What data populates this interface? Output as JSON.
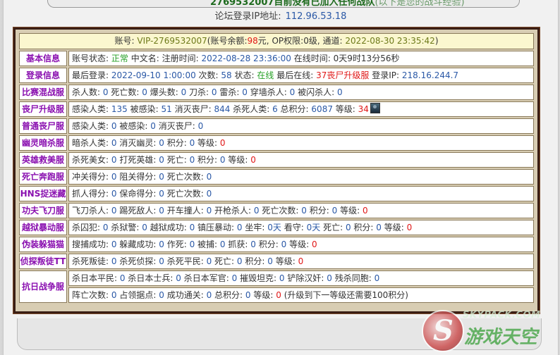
{
  "top_banner": {
    "text": "2769532007目前没有已加入任何战队",
    "tail": "(以下是您的战斗经验)"
  },
  "ip_bar": {
    "label": "论坛登录IP地址:",
    "value": "112.96.53.18"
  },
  "account": {
    "label": "账号:",
    "id": "VIP-2769532007",
    "balance_label": "(账号余额:",
    "balance": "98",
    "balance_unit": "元,",
    "op_label": "OP权限:",
    "op_level": "0",
    "op_unit": "级,",
    "channel_label": "通道:",
    "channel_time": "2022-08-30 23:35:42",
    "close": ")"
  },
  "rows": [
    {
      "cat": "基本信息",
      "text": "账号状态: 正常 中文名: 注册时间: 2022-08-28 23:36:00 在线时间: 0天9时13分56秒"
    },
    {
      "cat": "登录信息",
      "text": "最后登录: 2022-09-10 1:00:00 次数: 58 状态: 在线 最后在线: 37丧尸升级服 登录IP: 218.16.244.7"
    },
    {
      "cat": "比赛混战服",
      "text": "杀人数: 0 死亡数: 0 爆头数: 0 刀杀: 0 雷杀: 0 穿墙杀人: 0 被闪杀人: 0"
    },
    {
      "cat": "丧尸升级服",
      "text": "感染人类: 135 被感染: 51 消灭丧尸: 844 杀死人类: 6 总积分: 6087 等级: 34"
    },
    {
      "cat": "普通丧尸服",
      "text": "感染人类: 0 被感染: 0 消灭丧尸: 0"
    },
    {
      "cat": "幽灵暗杀服",
      "text": "暗杀人类: 0 消灭幽灵: 0 积分: 0 等级: 0"
    },
    {
      "cat": "英雄救美服",
      "text": "杀死美女: 0 打死英雄: 0 死亡: 0 积分: 0 等级: 0"
    },
    {
      "cat": "死亡奔跑服",
      "text": "冲关得分: 0 阻关得分: 0 死亡次数: 0"
    },
    {
      "cat": "HNS捉迷藏",
      "text": "抓人得分: 0 保命得分: 0 死亡次数: 0"
    },
    {
      "cat": "功夫飞刀服",
      "text": "飞刀杀人: 0 踢死敌人: 0 开车撞人: 0 开枪杀人: 0 死亡次数: 0 积分: 0 等级: 0"
    },
    {
      "cat": "越狱暴动服",
      "text": "杀囚犯: 0 杀狱警: 0 越狱成功: 0 镇压暴动: 0 坐牢: 0天 看守: 0天 死亡: 0 积分: 0 等级: 0"
    },
    {
      "cat": "伪装躲猫猫",
      "text": "搜捕成功: 0 躲藏成功: 0 作死: 0 被捕: 0 抓获: 0 积分: 0 等级: 0"
    },
    {
      "cat": "侦探叛徒TT",
      "text": "杀死叛徒: 0 杀死侦探: 0 杀死平民: 0 死亡: 0 积分: 0 等级: 0"
    }
  ],
  "antijapan": {
    "cat": "抗日战争服",
    "line1": "杀日本平民: 0 杀日本士兵: 0 杀日本军官: 0 摧毁坦克: 0 铲除汉奸: 0 残杀同胞: 0",
    "line2": "阵亡次数: 0 占领据点: 0 成功通关: 0 总积分: 0 等级: 0 (升级到下一等级还需要100积分)"
  },
  "watermark": {
    "line1": "SKYPACK.COM",
    "line2": "游戏天空"
  }
}
